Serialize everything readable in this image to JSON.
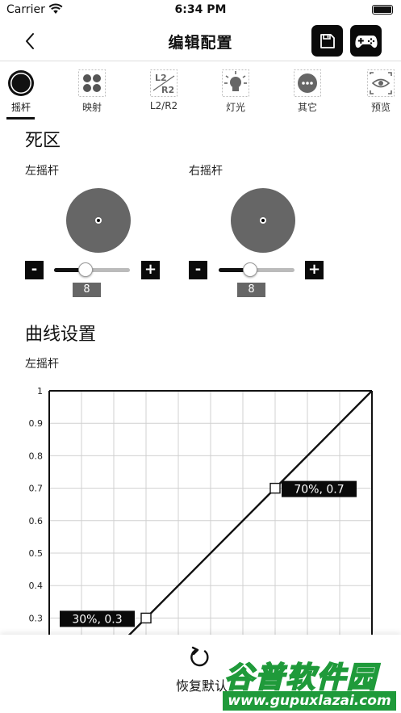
{
  "status_bar": {
    "carrier": "Carrier",
    "time": "6:34 PM"
  },
  "nav": {
    "title": "编辑配置",
    "back_icon": "chevron-left-icon",
    "save_icon": "floppy-disk-icon",
    "gamepad_icon": "gamepad-icon"
  },
  "tabs": [
    {
      "label": "摇杆",
      "icon": "joystick-icon",
      "active": true
    },
    {
      "label": "映射",
      "icon": "four-dots-icon",
      "active": false
    },
    {
      "label": "L2/R2",
      "icon": "l2-r2-icon",
      "active": false
    },
    {
      "label": "灯光",
      "icon": "light-bulb-icon",
      "active": false
    },
    {
      "label": "其它",
      "icon": "more-icon",
      "active": false
    },
    {
      "label": "预览",
      "icon": "eye-icon",
      "active": false
    }
  ],
  "deadzone": {
    "title": "死区",
    "left": {
      "label": "左摇杆",
      "value": "8",
      "slider_fraction": 0.42
    },
    "right": {
      "label": "右摇杆",
      "value": "8",
      "slider_fraction": 0.42
    },
    "minus_label": "-",
    "plus_label": "+"
  },
  "curve": {
    "title": "曲线设置",
    "stick_label": "左摇杆",
    "point_labels": [
      "30%, 0.3",
      "70%, 0.7"
    ]
  },
  "chart_data": {
    "type": "line",
    "title": "",
    "xlabel": "",
    "ylabel": "",
    "ylim": [
      0.3,
      1
    ],
    "xlim": [
      0,
      1
    ],
    "y_ticks": [
      "1",
      "0.9",
      "0.8",
      "0.7",
      "0.6",
      "0.5",
      "0.4",
      "0.3"
    ],
    "grid": true,
    "series": [
      {
        "x": [
          0,
          0.3,
          0.7,
          1
        ],
        "y": [
          0,
          0.3,
          0.7,
          1
        ]
      }
    ],
    "control_points": [
      {
        "x": 0.3,
        "y": 0.3,
        "label": "30%, 0.3"
      },
      {
        "x": 0.7,
        "y": 0.7,
        "label": "70%, 0.7"
      }
    ]
  },
  "bottom": {
    "reset_label": "恢复默认",
    "reset_icon": "refresh-icon"
  },
  "watermark": {
    "title": "谷普软件园",
    "url": "www.gupuxlazai.com"
  }
}
